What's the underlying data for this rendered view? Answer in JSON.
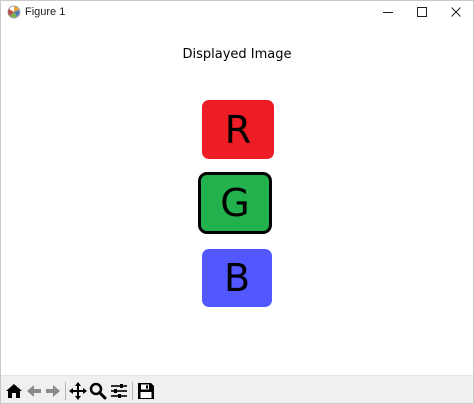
{
  "window": {
    "title": "Figure 1"
  },
  "figure": {
    "title": "Displayed Image",
    "swatches": [
      {
        "label": "R",
        "color": "#ee1c25",
        "selected": false
      },
      {
        "label": "G",
        "color": "#22b14c",
        "selected": true
      },
      {
        "label": "B",
        "color": "#5257ff",
        "selected": false
      }
    ]
  },
  "toolbar": {
    "tools": [
      "home-icon",
      "back-arrow-icon",
      "forward-arrow-icon",
      "pan-move-icon",
      "zoom-magnifier-icon",
      "subplots-sliders-icon",
      "save-floppy-icon"
    ]
  }
}
